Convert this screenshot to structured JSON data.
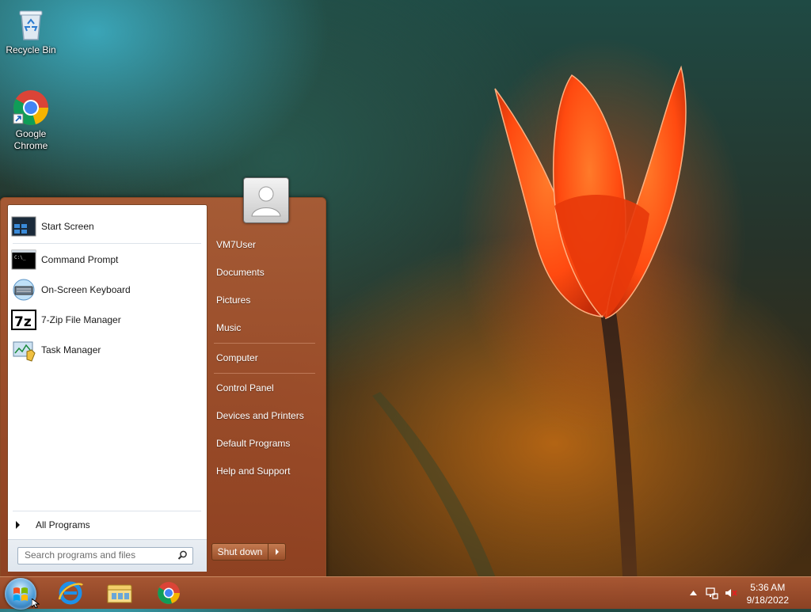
{
  "desktop": {
    "icons": [
      {
        "label": "Recycle Bin"
      },
      {
        "label_line1": "Google",
        "label_line2": "Chrome"
      }
    ]
  },
  "start_menu": {
    "pinned": [
      {
        "label": "Start Screen"
      },
      {
        "label": "Command Prompt"
      },
      {
        "label": "On-Screen Keyboard"
      },
      {
        "label": "7-Zip File Manager"
      },
      {
        "label": "Task Manager"
      }
    ],
    "all_programs": "All Programs",
    "search_placeholder": "Search programs and files",
    "right_items": [
      {
        "label": "VM7User"
      },
      {
        "label": "Documents"
      },
      {
        "label": "Pictures"
      },
      {
        "label": "Music"
      },
      {
        "label": "Computer"
      },
      {
        "label": "Control Panel"
      },
      {
        "label": "Devices and Printers"
      },
      {
        "label": "Default Programs"
      },
      {
        "label": "Help and Support"
      }
    ],
    "shutdown_label": "Shut down"
  },
  "taskbar": {
    "pinned_icons": [
      "internet-explorer-icon",
      "windows-explorer-icon",
      "google-chrome-icon"
    ],
    "tray_icons": [
      "show-hidden-icons-arrow",
      "network-icon",
      "volume-muted-icon"
    ],
    "clock_time": "5:36 AM",
    "clock_date": "9/18/2022"
  },
  "colors": {
    "start_menu_accent": "#a85a34",
    "taskbar": "#9c4f2c"
  }
}
